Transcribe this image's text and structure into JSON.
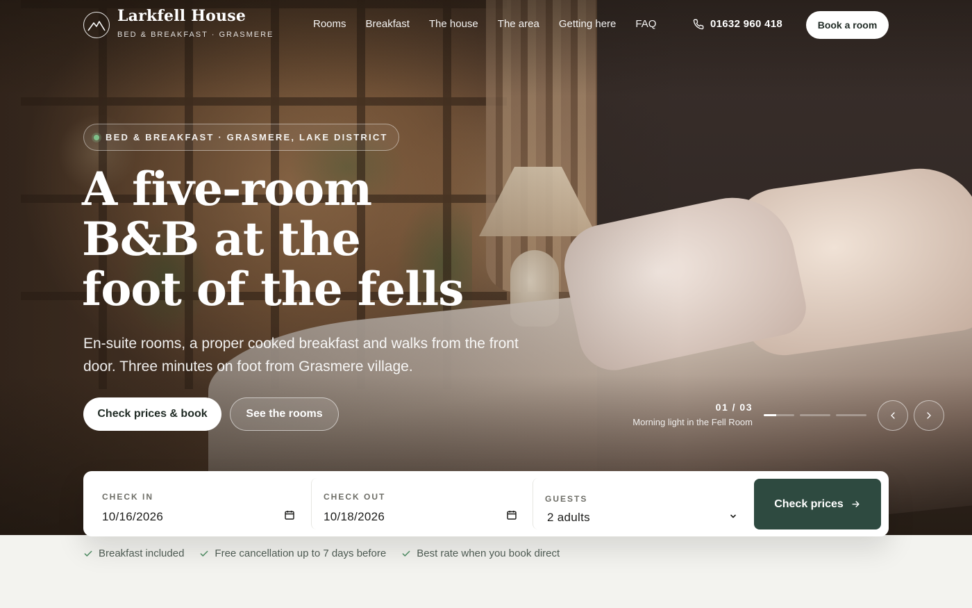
{
  "brand": {
    "name": "Larkfell House",
    "tagline": "BED & BREAKFAST · GRASMERE",
    "logo_icon": "mountain-icon"
  },
  "nav": {
    "items": [
      {
        "label": "Rooms"
      },
      {
        "label": "Breakfast"
      },
      {
        "label": "The house"
      },
      {
        "label": "The area"
      },
      {
        "label": "Getting here"
      },
      {
        "label": "FAQ"
      }
    ],
    "phone": "01632 960 418",
    "phone_icon": "phone-icon",
    "book_label": "Book a room"
  },
  "hero": {
    "eyebrow": "BED & BREAKFAST · GRASMERE, LAKE DISTRICT",
    "headline_lines": [
      "A five-room",
      "B&B at the",
      "foot of the fells"
    ],
    "subtext": "En-suite rooms, a proper cooked breakfast and walks from the front door. Three minutes on foot from Grasmere village.",
    "cta_primary": "Check prices & book",
    "cta_secondary": "See the rooms"
  },
  "carousel": {
    "counter": "01 / 03",
    "caption": "Morning light in the Fell Room",
    "current_slide": 1,
    "total_slides": 3,
    "prev_icon": "chevron-left-icon",
    "next_icon": "chevron-right-icon"
  },
  "booking": {
    "check_in": {
      "label": "CHECK IN",
      "value": "10/16/2026"
    },
    "check_out": {
      "label": "CHECK OUT",
      "value": "10/18/2026"
    },
    "guests": {
      "label": "GUESTS",
      "value": "2 adults"
    },
    "submit_label": "Check prices",
    "calendar_icon": "calendar-icon",
    "arrow_icon": "arrow-right-icon"
  },
  "benefits": [
    {
      "label": "Breakfast included"
    },
    {
      "label": "Free cancellation up to 7 days before"
    },
    {
      "label": "Best rate when you book direct"
    }
  ],
  "colors": {
    "primary_dark": "#2e4a40",
    "page_bg": "#f3f3ef",
    "status_dot": "#7fc08a",
    "benefit_text": "#4d5a52"
  }
}
